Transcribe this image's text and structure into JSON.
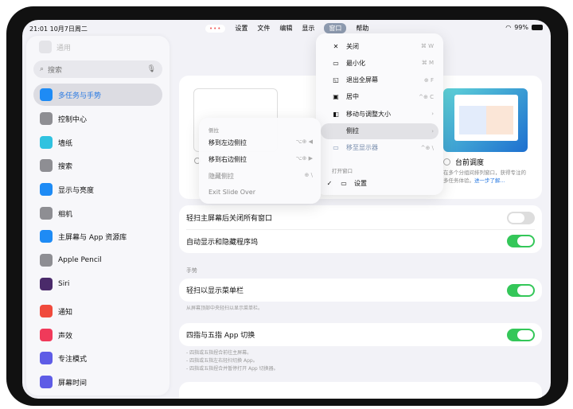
{
  "status": {
    "time": "21:01",
    "date": "10月7日周二",
    "battery": "99%"
  },
  "menubar": {
    "dots": "•••",
    "items": [
      "设置",
      "文件",
      "编辑",
      "显示",
      "窗口",
      "帮助"
    ],
    "selected": "窗口"
  },
  "sidebar": {
    "general": "通用",
    "search_placeholder": "搜索",
    "items": [
      {
        "label": "多任务与手势",
        "color": "#1e8bf5",
        "active": true
      },
      {
        "label": "控制中心",
        "color": "#8e8e93"
      },
      {
        "label": "墙纸",
        "color": "#30c2e0"
      },
      {
        "label": "搜索",
        "color": "#8e8e93"
      },
      {
        "label": "显示与亮度",
        "color": "#1e8bf5"
      },
      {
        "label": "相机",
        "color": "#8e8e93"
      },
      {
        "label": "主屏幕与 App 资源库",
        "color": "#1e8bf5"
      },
      {
        "label": "Apple Pencil",
        "color": "#8e8e93"
      },
      {
        "label": "Siri",
        "color": "#4a2a6a"
      },
      {
        "label": "通知",
        "color": "#f04a3c"
      },
      {
        "label": "声效",
        "color": "#f03a5a"
      },
      {
        "label": "专注模式",
        "color": "#5e5ce6"
      },
      {
        "label": "屏幕时间",
        "color": "#5e5ce6"
      }
    ]
  },
  "main": {
    "stage_manager": {
      "title": "台前调度",
      "desc": "在多个分组间排列窗口，获得专注的多任务体验。",
      "link": "进一步了解..."
    },
    "rows1": [
      {
        "label": "轻扫主屏幕后关闭所有窗口",
        "on": false
      },
      {
        "label": "自动显示和隐藏程序坞",
        "on": true
      }
    ],
    "gestures_header": "手势",
    "row_menubar": {
      "label": "轻扫以显示菜单栏",
      "on": true
    },
    "row_menubar_note": "从屏幕顶部中央轻扫以显示菜单栏。",
    "row_switch": {
      "label": "四指与五指 App 切换",
      "on": true
    },
    "row_switch_notes": [
      "- 四指或五指捏合前往主屏幕。",
      "- 四指或五指左右轻扫切换 App。",
      "- 四指或五指捏合并暂停打开 App 切换器。"
    ]
  },
  "window_menu": {
    "items": [
      {
        "icon": "✕",
        "label": "关闭",
        "shortcut": "⌘ W"
      },
      {
        "icon": "▭",
        "label": "最小化",
        "shortcut": "⌘ M"
      },
      {
        "icon": "◱",
        "label": "退出全屏幕",
        "shortcut": "⊕ F"
      },
      {
        "icon": "▣",
        "label": "居中",
        "shortcut": "^⊕ C"
      },
      {
        "icon": "◧",
        "label": "移动与调整大小",
        "shortcut": "›"
      },
      {
        "icon": "",
        "label": "侧拉",
        "shortcut": "›"
      },
      {
        "icon": "▭",
        "label": "移至显示器",
        "shortcut": "^⊕ \\"
      }
    ],
    "open_windows_header": "打开窗口",
    "open_window": "设置",
    "check": "✓"
  },
  "slide_menu": {
    "header": "侧拉",
    "items": [
      {
        "label": "移到左边侧拉",
        "shortcut": "⌥⊕ ◀"
      },
      {
        "label": "移到右边侧拉",
        "shortcut": "⌥⊕ ▶"
      },
      {
        "label": "隐藏侧拉",
        "shortcut": "⊕ \\"
      },
      {
        "label": "Exit Slide Over",
        "shortcut": ""
      }
    ]
  }
}
